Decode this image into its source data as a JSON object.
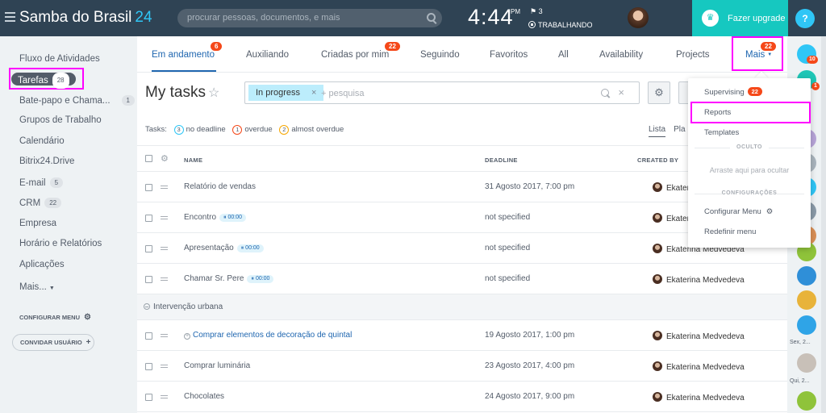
{
  "header": {
    "brand": "Samba do Brasil",
    "brand_num": "24",
    "search_placeholder": "procurar pessoas, documentos, e mais",
    "time": "4:44",
    "ampm": "PM",
    "flag_count": "3",
    "work_status": "TRABALHANDO",
    "upgrade_label": "Fazer upgrade",
    "help_label": "?"
  },
  "sidebar": {
    "items": [
      {
        "label": "Fluxo de Atividades"
      },
      {
        "label": "Tarefas",
        "count": "28"
      },
      {
        "label": "Bate-papo e Chama...",
        "count": "1"
      },
      {
        "label": "Grupos de Trabalho"
      },
      {
        "label": "Calendário"
      },
      {
        "label": "Bitrix24.Drive"
      },
      {
        "label": "E-mail",
        "count": "5"
      },
      {
        "label": "CRM",
        "count": "22"
      },
      {
        "label": "Empresa"
      },
      {
        "label": "Horário e Relatórios"
      },
      {
        "label": "Aplicações"
      },
      {
        "label": "Mais..."
      }
    ],
    "config_menu": "CONFIGURAR MENU",
    "invite": "CONVIDAR USUÁRIO"
  },
  "tabs": [
    {
      "label": "Em andamento",
      "badge": "6"
    },
    {
      "label": "Auxiliando"
    },
    {
      "label": "Criadas por mim",
      "badge": "22"
    },
    {
      "label": "Seguindo"
    },
    {
      "label": "Favoritos"
    },
    {
      "label": "All"
    },
    {
      "label": "Availability"
    },
    {
      "label": "Projects"
    },
    {
      "label": "Mais",
      "badge": "22"
    }
  ],
  "page": {
    "title": "My tasks",
    "filter_chip": "In progress",
    "filter_placeholder": "+ pesquisa"
  },
  "stats": {
    "prefix": "Tasks:",
    "no_deadline_count": "3",
    "no_deadline_label": "no deadline",
    "overdue_count": "1",
    "overdue_label": "overdue",
    "almost_count": "2",
    "almost_label": "almost overdue",
    "view_list": "Lista",
    "view_plan": "Pla"
  },
  "table": {
    "headers": {
      "name": "NAME",
      "deadline": "DEADLINE",
      "created_by": "CREATED BY"
    },
    "rows": [
      {
        "name": "Relatório de vendas",
        "deadline": "31 Agosto 2017, 7:00 pm",
        "creator": "Ekaterina Medvedeva"
      },
      {
        "name": "Encontro",
        "timer": "00:00",
        "deadline": "not specified",
        "creator": "Ekaterina Medvedeva"
      },
      {
        "name": "Apresentação",
        "timer": "00:00",
        "deadline": "not specified",
        "creator": "Ekaterina Medvedeva"
      },
      {
        "name": "Chamar Sr. Pere",
        "timer": "00:00",
        "deadline": "not specified",
        "creator": "Ekaterina Medvedeva"
      }
    ],
    "group_label": "Intervenção urbana",
    "group_rows": [
      {
        "name": "Comprar elementos de decoração de quintal",
        "deadline": "19 Agosto 2017, 1:00 pm",
        "creator": "Ekaterina Medvedeva"
      },
      {
        "name": "Comprar luminária",
        "deadline": "23 Agosto 2017, 4:00 pm",
        "creator": "Ekaterina Medvedeva"
      },
      {
        "name": "Chocolates",
        "deadline": "24 Agosto 2017, 9:00 pm",
        "creator": "Ekaterina Medvedeva"
      }
    ]
  },
  "dropdown": {
    "supervising": "Supervising",
    "supervising_badge": "22",
    "reports": "Reports",
    "templates": "Templates",
    "hidden_section": "OCULTO",
    "drag_hint": "Arraste aqui para ocultar",
    "config_section": "CONFIGURAÇÕES",
    "config_menu": "Configurar Menu",
    "reset_menu": "Redefinir menu"
  },
  "rail": {
    "badge1": "10",
    "badge2": "1",
    "date1": "Sex, 2...",
    "date2": "Qui, 2..."
  },
  "colors": {
    "topbar": "#2f4354",
    "accent": "#2fc6f6",
    "upgrade": "#16c8c0",
    "badge": "#f54819",
    "highlight": "#ff00ff",
    "link": "#2067b0"
  }
}
